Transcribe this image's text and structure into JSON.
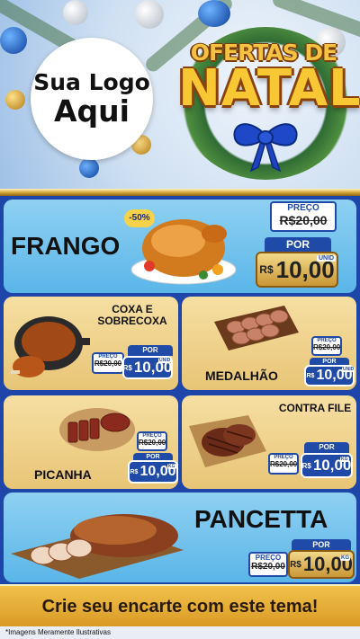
{
  "logo": {
    "line1": "Sua Logo",
    "line2": "Aqui"
  },
  "title": {
    "top": "OFERTAS DE",
    "main": "NATAL"
  },
  "products": {
    "frango": {
      "name": "FRANGO",
      "badge": "-50%",
      "preco_label": "PREÇO",
      "old_price": "R$20,00",
      "por_label": "POR",
      "currency": "R$",
      "price": "10,00",
      "unit": "UNID"
    },
    "coxa": {
      "name": "COXA E SOBRECOXA",
      "preco_label": "PREÇO",
      "old_price": "R$20,00",
      "por_label": "POR",
      "currency": "R$",
      "price": "10,00",
      "unit": "UNID"
    },
    "medalhao": {
      "name": "MEDALHÃO",
      "preco_label": "PREÇO",
      "old_price": "R$20,00",
      "por_label": "POR",
      "currency": "R$",
      "price": "10,00",
      "unit": "UNID"
    },
    "picanha": {
      "name": "PICANHA",
      "preco_label": "PREÇO",
      "old_price": "R$20,00",
      "por_label": "POR",
      "currency": "R$",
      "price": "10,00",
      "unit": "KG"
    },
    "contrafile": {
      "name": "CONTRA FILE",
      "preco_label": "PREÇO",
      "old_price": "R$20,00",
      "por_label": "POR",
      "currency": "R$",
      "price": "10,00",
      "unit": "KG"
    },
    "pancetta": {
      "name": "PANCETTA",
      "preco_label": "PREÇO",
      "old_price": "R$20,00",
      "por_label": "POR",
      "currency": "R$",
      "price": "10,00",
      "unit": "KG"
    }
  },
  "footer": {
    "cta": "Crie seu encarte com este tema!"
  },
  "disclaimer": "*Imagens Meramente Ilustrativas",
  "colors": {
    "accent_blue": "#1f4aa8",
    "gold": "#e8c576",
    "sky": "#5ab6e8"
  }
}
